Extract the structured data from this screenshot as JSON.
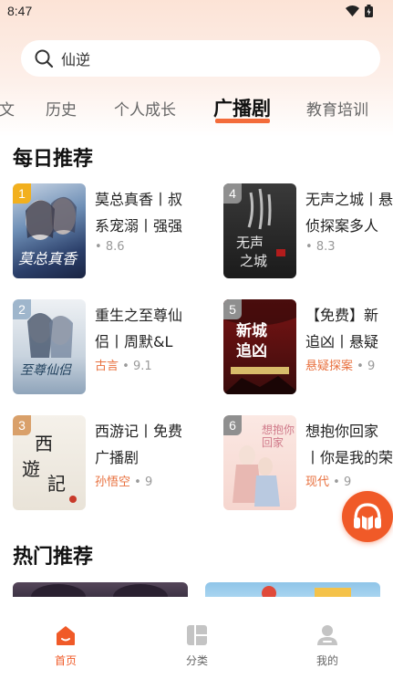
{
  "status_bar": {
    "time": "8:47"
  },
  "search": {
    "query": "仙逆"
  },
  "tabs": [
    {
      "label": "文"
    },
    {
      "label": "历史"
    },
    {
      "label": "个人成长"
    },
    {
      "label": "广播剧"
    },
    {
      "label": "教育培训"
    }
  ],
  "active_tab": "广播剧",
  "daily": {
    "title": "每日推荐",
    "books": [
      {
        "rank": "1",
        "title_line1": "莫总真香丨叔",
        "title_line2": "系宠溺丨强强",
        "tag": "",
        "rating": "8.6",
        "badge_color": "#f2b01e",
        "cover_text": "莫总真香"
      },
      {
        "rank": "4",
        "title_line1": "无声之城丨悬",
        "title_line2": "侦探案多人",
        "tag": "",
        "rating": "8.3",
        "badge_color": "#9a9a9a",
        "cover_text": "无声之城"
      },
      {
        "rank": "2",
        "title_line1": "重生之至尊仙",
        "title_line2": "侣丨周默&L",
        "tag": "古言",
        "rating": "9.1",
        "badge_color": "#9fb6cc",
        "cover_text": "至尊仙侣"
      },
      {
        "rank": "5",
        "title_line1": "【免费】新",
        "title_line2": "追凶丨悬疑",
        "tag": "悬疑探案",
        "rating": "9",
        "badge_color": "#9a9a9a",
        "cover_text": "新城追凶"
      },
      {
        "rank": "3",
        "title_line1": "西游记丨免费",
        "title_line2": "广播剧",
        "tag": "孙悟空",
        "rating": "9",
        "badge_color": "#d9a06a",
        "cover_text": "西游記"
      },
      {
        "rank": "6",
        "title_line1": "想抱你回家",
        "title_line2": "丨你是我的荣",
        "tag": "现代",
        "rating": "9",
        "badge_color": "#9a9a9a",
        "cover_text": "想抱你回家"
      }
    ]
  },
  "hot": {
    "title": "热门推荐"
  },
  "bottom_nav": [
    {
      "label": "首页",
      "icon": "home-icon"
    },
    {
      "label": "分类",
      "icon": "category-icon"
    },
    {
      "label": "我的",
      "icon": "profile-icon"
    }
  ],
  "colors": {
    "accent": "#f05a28",
    "tag": "#e8703e"
  }
}
